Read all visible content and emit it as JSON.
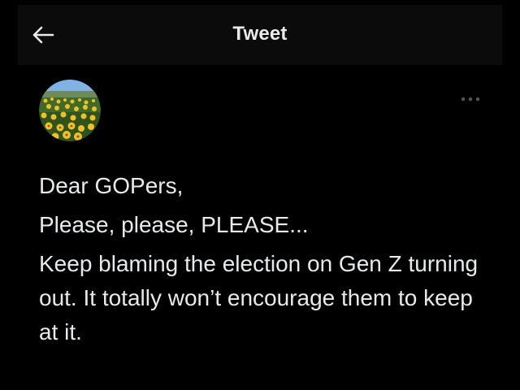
{
  "status_bar": {
    "dots": "..."
  },
  "header": {
    "title": "Tweet",
    "back_icon": "arrow-left-icon"
  },
  "tweet": {
    "author_avatar": "flower-field-avatar",
    "more_icon": "ellipsis-icon",
    "paragraphs": [
      "Dear GOPers,",
      "Please, please, PLEASE...",
      "Keep blaming the election on Gen Z turning out. It totally won’t encourage them to keep at it."
    ]
  },
  "colors": {
    "background": "#000000",
    "header_bg": "#0b0b0b",
    "text": "#e7e9ea",
    "icon_muted": "#555555"
  }
}
